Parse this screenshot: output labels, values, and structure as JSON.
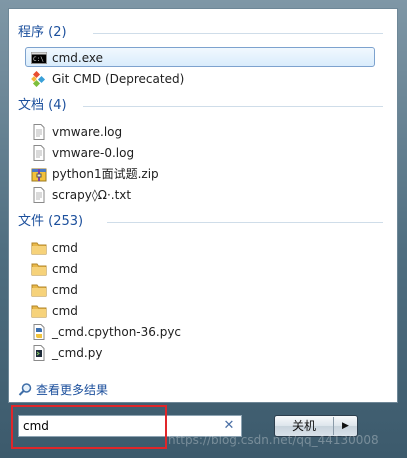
{
  "groups": {
    "programs": {
      "title": "程序 (2)",
      "items": [
        {
          "label": "cmd.exe",
          "icon": "cmd-console-icon",
          "selected": true
        },
        {
          "label": "Git CMD (Deprecated)",
          "icon": "git-icon",
          "selected": false
        }
      ]
    },
    "documents": {
      "title": "文档 (4)",
      "items": [
        {
          "label": "vmware.log",
          "icon": "text-file-icon"
        },
        {
          "label": "vmware-0.log",
          "icon": "text-file-icon"
        },
        {
          "label": "python1面试题.zip",
          "icon": "zip-archive-icon"
        },
        {
          "label": "scrapy◊Ω·.txt",
          "icon": "text-file-icon"
        }
      ]
    },
    "files": {
      "title": "文件 (253)",
      "items": [
        {
          "label": "cmd",
          "icon": "folder-icon"
        },
        {
          "label": "cmd",
          "icon": "folder-icon"
        },
        {
          "label": "cmd",
          "icon": "folder-icon"
        },
        {
          "label": "cmd",
          "icon": "folder-icon"
        },
        {
          "label": "_cmd.cpython-36.pyc",
          "icon": "python-compiled-icon"
        },
        {
          "label": "_cmd.py",
          "icon": "python-file-icon"
        }
      ]
    }
  },
  "see_more": {
    "label": "查看更多结果",
    "icon": "search-icon"
  },
  "search": {
    "value": "cmd",
    "placeholder": "",
    "clear_icon": "close-icon"
  },
  "shutdown": {
    "label": "关机",
    "arrow_icon": "arrow-right-icon"
  },
  "watermark": "https://blog.csdn.net/qq_44130008",
  "colors": {
    "group_title": "#1b4f9c",
    "selection_border": "#7da2ce",
    "highlight_red": "#e0262a"
  }
}
